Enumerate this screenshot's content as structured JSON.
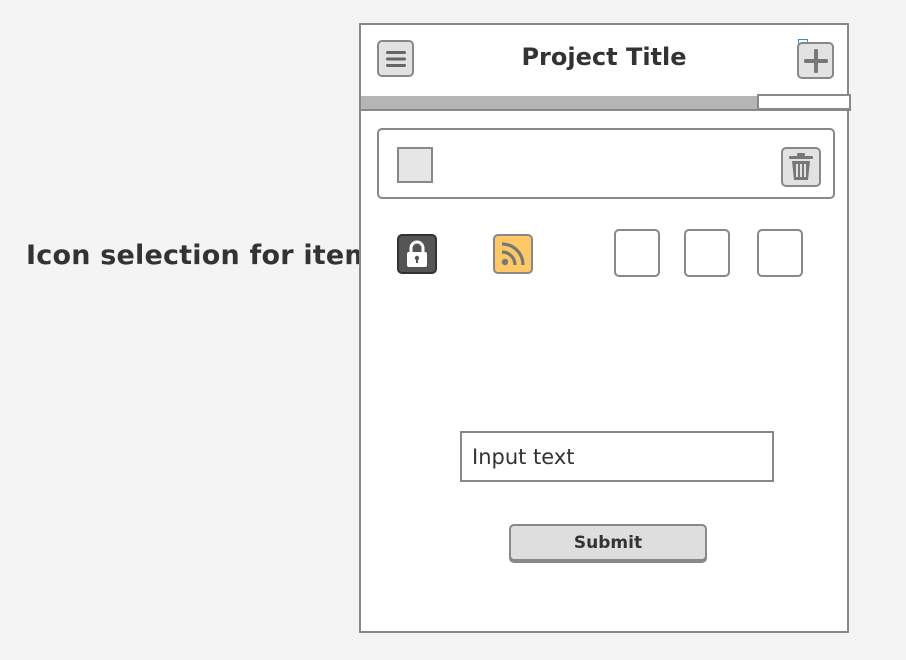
{
  "annotation": {
    "label": "Icon selection for items"
  },
  "header": {
    "title": "Project Title",
    "menu_icon": "hamburger-menu-icon",
    "add_icon": "plus-icon"
  },
  "progress": {
    "value_fraction": 0.81
  },
  "item": {
    "checkbox_checked": false,
    "delete_icon": "trash-icon"
  },
  "icon_options": [
    {
      "icon": "lock-icon",
      "color": "#555555"
    },
    {
      "icon": "rss-feed-icon",
      "color": "#ffc866"
    }
  ],
  "empty_slots": 3,
  "form": {
    "input_placeholder": "Input text",
    "input_value": "",
    "submit_label": "Submit"
  }
}
